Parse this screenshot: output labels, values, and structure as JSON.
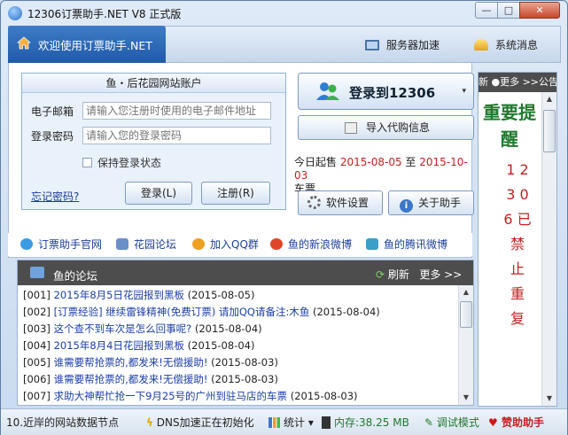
{
  "window": {
    "title": "12306订票助手.NET V8 正式版",
    "min": "—",
    "max": "□",
    "close": "✕"
  },
  "header": {
    "welcome": "欢迎使用订票助手.NET",
    "dns_btn": "服务器加速",
    "msg_btn": "系统消息"
  },
  "account": {
    "heading": "鱼・后花园网站账户",
    "email_label": "电子邮箱",
    "email_placeholder": "请输入您注册时使用的电子邮件地址",
    "pwd_label": "登录密码",
    "pwd_placeholder": "请输入您的登录密码",
    "remember": "保持登录状态",
    "forgot": "忘记密码?",
    "login": "登录(L)",
    "register": "注册(R)"
  },
  "actions": {
    "login12306": "登录到12306",
    "arrow": "▾",
    "import": "导入代购信息",
    "settings": "软件设置",
    "about": "关于助手"
  },
  "sale": {
    "prefix": "今日起售",
    "from": "2015-08-05",
    "mid": "至",
    "to": "2015-10-03",
    "suffix": "车票"
  },
  "links": [
    {
      "label": "订票助手官网",
      "color": "#3b9be0"
    },
    {
      "label": "花园论坛",
      "color": "#6a8fc9"
    },
    {
      "label": "加入QQ群",
      "color": "#f0a020"
    },
    {
      "label": "鱼的新浪微博",
      "color": "#e0452a"
    },
    {
      "label": "鱼的腾讯微博",
      "color": "#3aa0c8"
    }
  ],
  "forum": {
    "title": "鱼的论坛",
    "refresh": "刷新",
    "more": "更多 >>",
    "rows": [
      {
        "num": "[001]",
        "title": "2015年8月5日花园报到黑板",
        "date": "(2015-08-05)"
      },
      {
        "num": "[002]",
        "title": "[订票经验] 继续雷锋精神(免费订票) 请加QQ请备注:木鱼",
        "date": "(2015-08-04)"
      },
      {
        "num": "[003]",
        "title": "这个查不到车次是怎么回事呢?",
        "date": "(2015-08-04)"
      },
      {
        "num": "[004]",
        "title": "2015年8月4日花园报到黑板",
        "date": "(2015-08-04)"
      },
      {
        "num": "[005]",
        "title": "谁需要帮抢票的,都发来!无偿援助!",
        "date": "(2015-08-03)"
      },
      {
        "num": "[006]",
        "title": "谁需要帮抢票的,都发来!无偿援助!",
        "date": "(2015-08-03)"
      },
      {
        "num": "[007]",
        "title": "求助大神帮忙抢一下9月25号的广州到驻马店的车票",
        "date": "(2015-08-03)"
      }
    ]
  },
  "notice": {
    "head": "新 ●更多 >>公告",
    "title": "重要提醒",
    "items": "1 2 3 0 6 已 禁 止 重 复"
  },
  "status": {
    "node": "10.近岸的网站数据节点",
    "dns": "DNS加速正在初始化",
    "stats": "统计",
    "stats_arrow": "▾",
    "mem": "内存:38.25 MB",
    "debug": "调试模式",
    "sponsor": "赞助助手"
  }
}
